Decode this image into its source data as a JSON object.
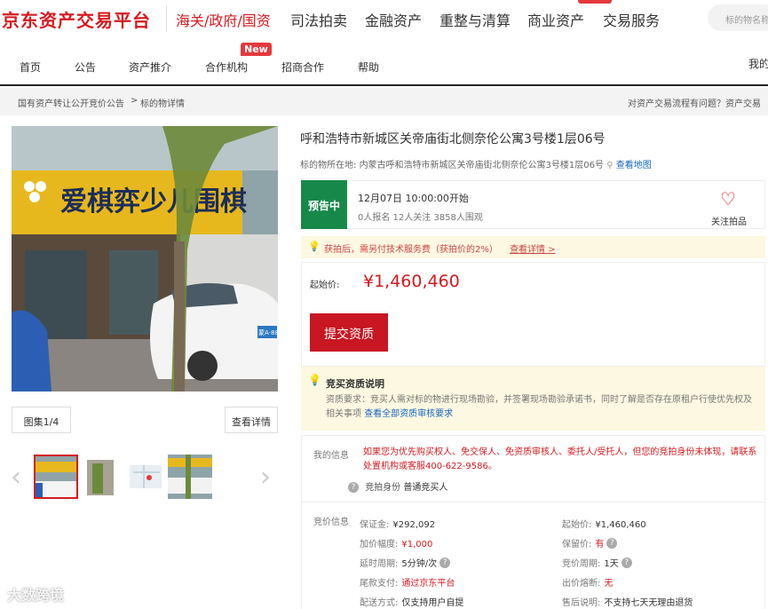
{
  "brand": "京东资产交易平台",
  "categories": [
    "海关/政府/国资",
    "司法拍卖",
    "金融资产",
    "重整与清算",
    "商业资产",
    "交易服务"
  ],
  "search": {
    "placeholder": "标的物名称"
  },
  "subnav": {
    "items": [
      "首页",
      "公告",
      "资产推介",
      "合作机构",
      "招商合作",
      "帮助"
    ],
    "new_badge": "New",
    "my_link": "我的"
  },
  "breadcrumb": {
    "items": [
      "国有资产转让公开竞价公告",
      "标的物详情"
    ],
    "separator": ">",
    "help": "对资产交易流程有问题？资产交易"
  },
  "gallery": {
    "count_label": "图集1/4",
    "detail_button": "查看详情",
    "shop_sign": "爱棋弈少儿围棋",
    "plate": "蒙A·88"
  },
  "item": {
    "title": "呼和浩特市新城区关帝庙街北侧奈伦公寓3号楼1层06号",
    "location_label": "标的物所在地:",
    "location": "内蒙古呼和浩特市新城区关帝庙街北侧奈伦公寓3号楼1层06号",
    "map_link": "查看地图"
  },
  "status": {
    "tag": "预告中",
    "start_time": "12月07日 10:00:00开始",
    "stats": "0人报名  12人关注  3858人围观",
    "follow_label": "关注拍品"
  },
  "tip": {
    "text": "获拍后，需另付技术服务费（获拍价的2%）",
    "link": "查看详情 >"
  },
  "price": {
    "label": "起始价:",
    "value": "¥1,460,460",
    "submit_button": "提交资质"
  },
  "notice": {
    "title": "竞买资质说明",
    "body": "资质要求：竞买人需对标的物进行现场勘验，并签署现场勘验承诺书，同时了解是否存在原租户行使优先权及相关事项",
    "link": "查看全部资质审核要求"
  },
  "my_info": {
    "label": "我的信息",
    "warning": "如果您为优先购买权人、免交保人、免资质审核人、委托人/受托人，但您的竞拍身份未体现，请联系处置机构或客服400-622-9586。",
    "identity_label": "竞拍身份",
    "identity_value": "普通竞买人"
  },
  "bid_info": {
    "label": "竞价信息",
    "left": [
      {
        "k": "保证金:",
        "v": "¥292,092",
        "red": false,
        "help": false
      },
      {
        "k": "加价幅度:",
        "v": "¥1,000",
        "red": true,
        "help": false
      },
      {
        "k": "延时周期:",
        "v": "5分钟/次",
        "red": false,
        "help": true
      },
      {
        "k": "尾款支付:",
        "v": "通过京东平台",
        "red": true,
        "help": false
      },
      {
        "k": "配送方式:",
        "v": "仅支持用户自提",
        "red": false,
        "help": false
      }
    ],
    "right": [
      {
        "k": "起始价:",
        "v": "¥1,460,460",
        "red": false,
        "help": false
      },
      {
        "k": "保留价:",
        "v": "有",
        "red": true,
        "help": true
      },
      {
        "k": "竞价周期:",
        "v": "1天",
        "red": false,
        "help": true
      },
      {
        "k": "出价熔断:",
        "v": "无",
        "red": true,
        "help": false
      },
      {
        "k": "售后说明:",
        "v": "不支持七天无理由退货",
        "red": false,
        "help": false
      }
    ]
  },
  "watermark": "大数跨境",
  "colors": {
    "brand_red": "#d51a1f",
    "status_green": "#18884a",
    "button_red": "#c81623",
    "link_blue": "#1565c0"
  }
}
